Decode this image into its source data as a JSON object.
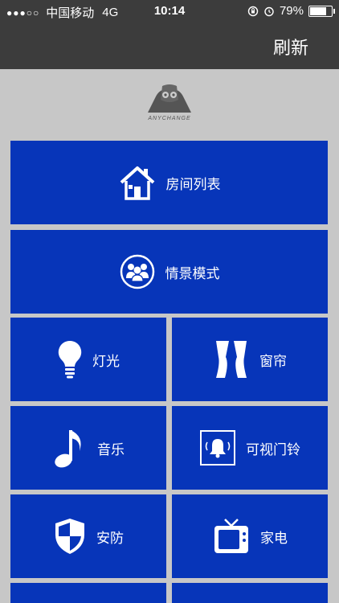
{
  "status_bar": {
    "signal_dots": "●●●○○",
    "carrier": "中国移动",
    "network": "4G",
    "time": "10:14",
    "battery": "79%",
    "battery_level": 0.79
  },
  "nav": {
    "refresh_label": "刷新"
  },
  "logo": {
    "text": "ANYCHANGE"
  },
  "tiles": {
    "room_list": "房间列表",
    "scene_mode": "情景模式",
    "light": "灯光",
    "curtain": "窗帘",
    "music": "音乐",
    "video_doorbell": "可视门铃",
    "security": "安防",
    "appliance": "家电"
  },
  "colors": {
    "tile_bg": "#0735b9",
    "page_bg": "#c7c7c7",
    "bar_bg": "#3c3c3c"
  }
}
